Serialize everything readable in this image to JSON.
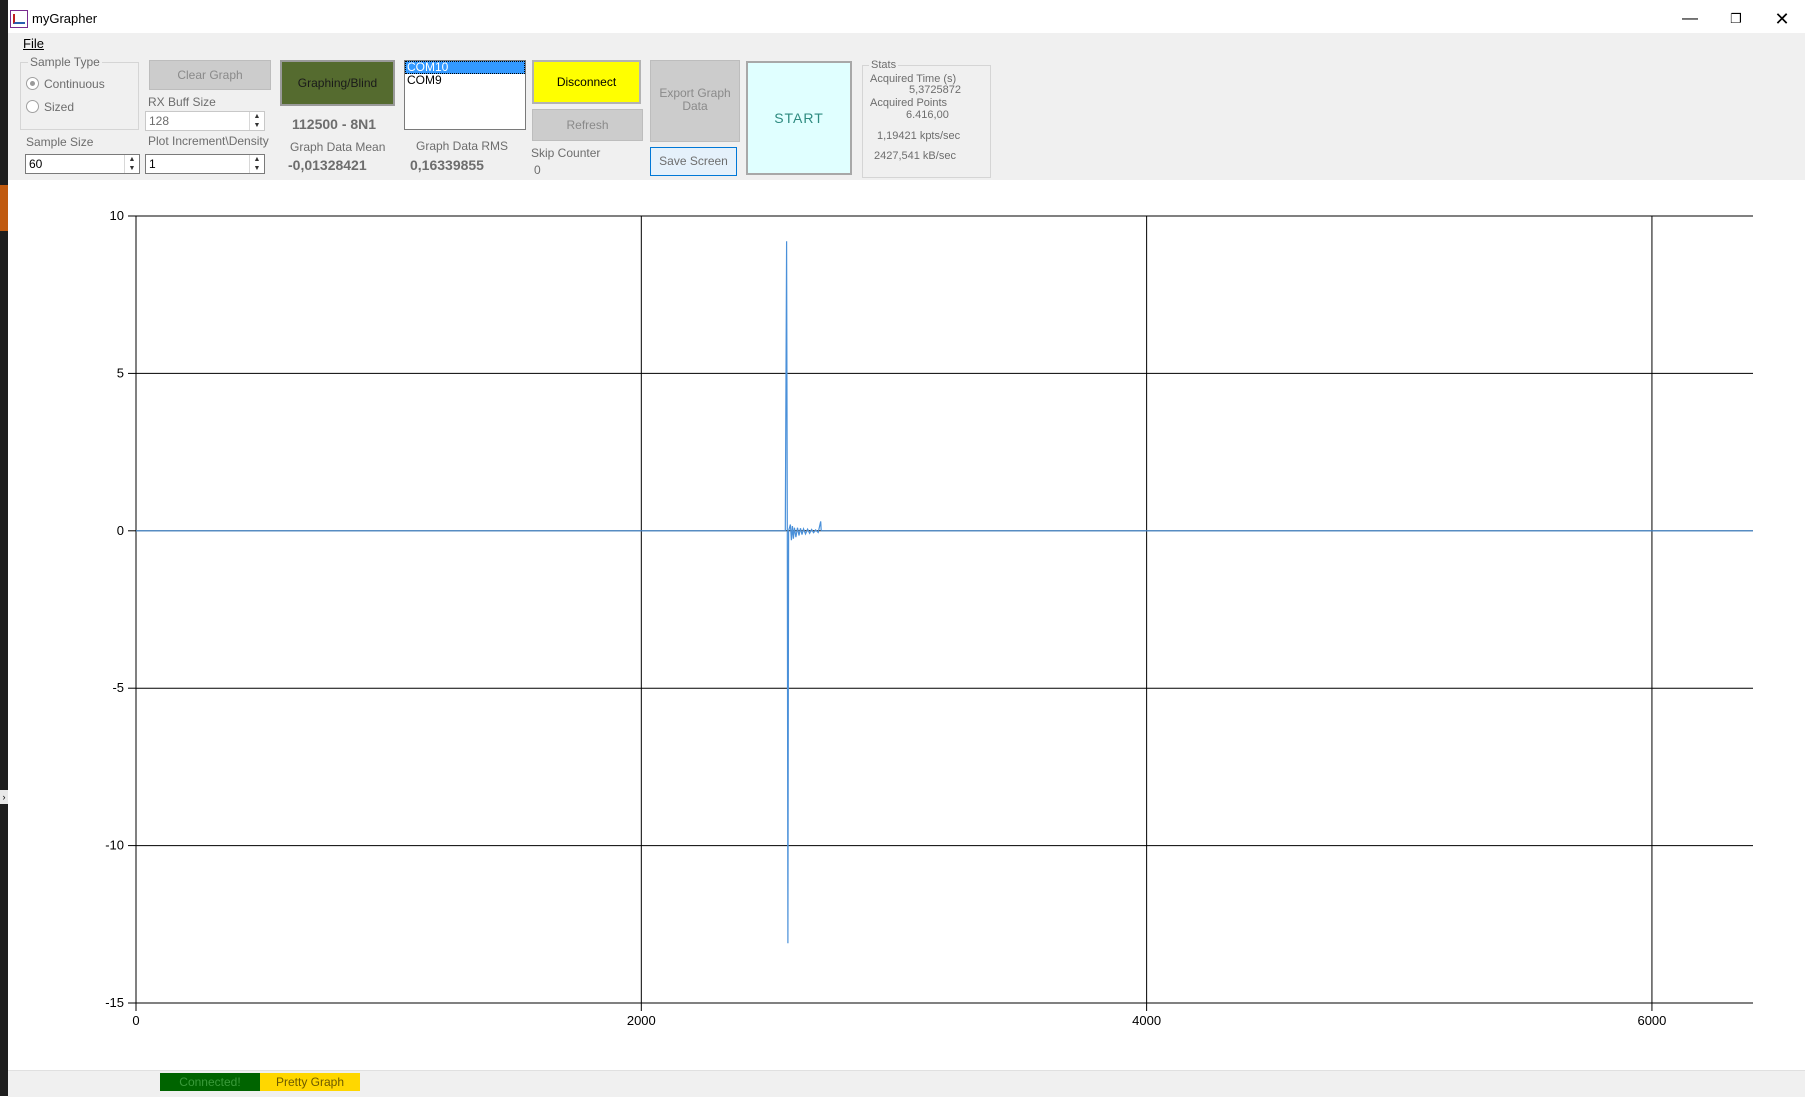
{
  "window": {
    "title": "myGrapher",
    "minimize_glyph": "—",
    "maximize_glyph": "❐",
    "close_glyph": "✕"
  },
  "menu": {
    "file": "File"
  },
  "controls": {
    "sample_type_title": "Sample Type",
    "sample_type_options": [
      "Continuous",
      "Sized"
    ],
    "sample_type_selected": "Continuous",
    "clear_graph": "Clear Graph",
    "rx_buff_label": "RX Buff Size",
    "rx_buff_value": "128",
    "sample_size_label": "Sample Size",
    "sample_size_value": "60",
    "plot_increment_label": "Plot Increment\\Density",
    "plot_increment_value": "1",
    "graphing_blind": "Graphing/Blind",
    "baud": "112500 - 8N1",
    "graph_data_mean_label": "Graph Data Mean",
    "graph_data_mean_value": "-0,01328421",
    "graph_data_rms_label": "Graph Data RMS",
    "graph_data_rms_value": "0,16339855",
    "com_ports": [
      "COM10",
      "COM9"
    ],
    "com_selected": "COM10",
    "disconnect": "Disconnect",
    "refresh": "Refresh",
    "skip_counter_label": "Skip Counter",
    "skip_counter_value": "0",
    "export_graph_data": "Export Graph Data",
    "save_screen": "Save Screen",
    "start": "START"
  },
  "stats": {
    "title": "Stats",
    "acquired_time_label": "Acquired Time (s)",
    "acquired_time_value": "5,3725872",
    "acquired_points_label": "Acquired Points",
    "acquired_points_value": "6.416,00",
    "kpts_rate": "1,19421 kpts/sec",
    "kb_rate": "2427,541 kB/sec"
  },
  "status": {
    "connected": "Connected!",
    "pretty_graph": "Pretty Graph"
  },
  "colors": {
    "series": "#4a90d9",
    "start_bg": "#e0ffff",
    "disconnect_bg": "#ffff00",
    "graphing_bg": "#556b2f",
    "connected_bg": "#006400",
    "pretty_bg": "#ffd700"
  },
  "chart_data": {
    "type": "line",
    "xlim": [
      0,
      6400
    ],
    "ylim": [
      -15,
      10
    ],
    "x_ticks": [
      0,
      2000,
      4000,
      6000
    ],
    "y_ticks": [
      10,
      5,
      0,
      -5,
      -10,
      -15
    ],
    "grid": true,
    "series": [
      {
        "points": [
          [
            0,
            0
          ],
          [
            2570,
            0
          ],
          [
            2575,
            9.2
          ],
          [
            2578,
            0
          ],
          [
            2580,
            -13.1
          ],
          [
            2583,
            0
          ],
          [
            2590,
            0.2
          ],
          [
            2594,
            -0.3
          ],
          [
            2598,
            0.15
          ],
          [
            2602,
            -0.25
          ],
          [
            2606,
            0.1
          ],
          [
            2612,
            -0.2
          ],
          [
            2618,
            0.1
          ],
          [
            2624,
            -0.15
          ],
          [
            2630,
            0.08
          ],
          [
            2636,
            -0.12
          ],
          [
            2642,
            0.06
          ],
          [
            2650,
            -0.1
          ],
          [
            2658,
            0.05
          ],
          [
            2666,
            -0.08
          ],
          [
            2674,
            0.04
          ],
          [
            2682,
            -0.06
          ],
          [
            2690,
            0.03
          ],
          [
            2700,
            -0.05
          ],
          [
            2710,
            0.3
          ],
          [
            2712,
            0
          ],
          [
            6400,
            0
          ]
        ]
      }
    ]
  }
}
